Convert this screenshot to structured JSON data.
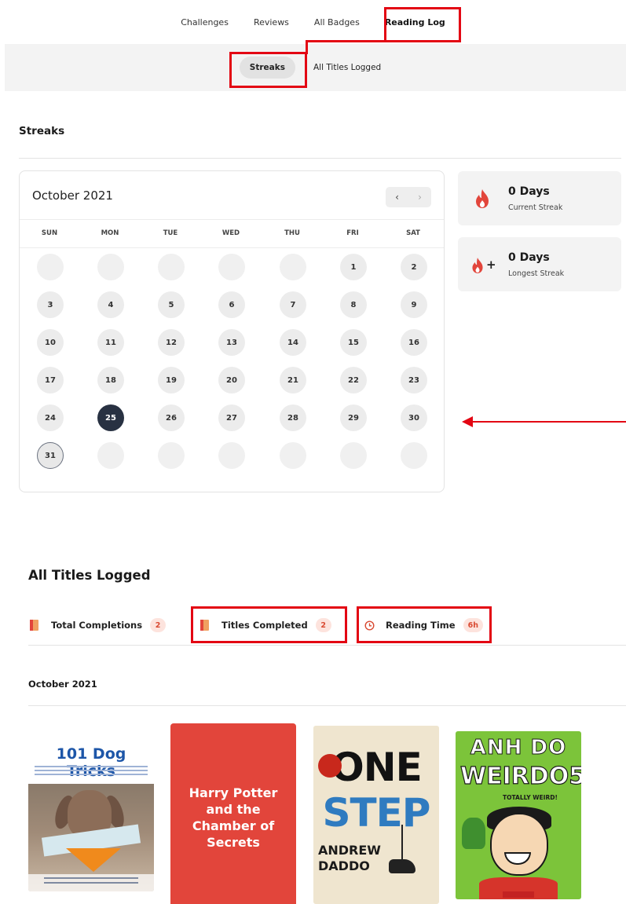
{
  "nav": {
    "tabs": [
      {
        "label": "Challenges"
      },
      {
        "label": "Reviews"
      },
      {
        "label": "All Badges"
      },
      {
        "label": "Reading Log"
      }
    ],
    "subtabs": [
      {
        "label": "Streaks"
      },
      {
        "label": "All Titles Logged"
      }
    ]
  },
  "streaks": {
    "heading": "Streaks",
    "calendar": {
      "month_label": "October 2021",
      "prev_icon": "‹",
      "next_icon": "›",
      "weekdays": [
        "SUN",
        "MON",
        "TUE",
        "WED",
        "THU",
        "FRI",
        "SAT"
      ],
      "days": [
        "1",
        "2",
        "3",
        "4",
        "5",
        "6",
        "7",
        "8",
        "9",
        "10",
        "11",
        "12",
        "13",
        "14",
        "15",
        "16",
        "17",
        "18",
        "19",
        "20",
        "21",
        "22",
        "23",
        "24",
        "25",
        "26",
        "27",
        "28",
        "29",
        "30",
        "31"
      ],
      "today": "25",
      "outlined": "31"
    },
    "current": {
      "value": "0 Days",
      "label": "Current Streak",
      "icon": "flame-icon"
    },
    "longest": {
      "value": "0 Days",
      "label": "Longest Streak",
      "icon": "flame-plus-icon",
      "plus": "+"
    }
  },
  "titles": {
    "heading": "All Titles Logged",
    "stats": [
      {
        "label": "Total Completions",
        "count": "2",
        "icon": "book-icon"
      },
      {
        "label": "Titles Completed",
        "count": "2",
        "icon": "book-icon"
      },
      {
        "label": "Reading Time",
        "count": "6h",
        "icon": "clock-icon"
      }
    ],
    "month_label": "October 2021",
    "books": [
      {
        "title": "101 Dog Tricks"
      },
      {
        "title": "Harry Potter and the Chamber of Secrets"
      },
      {
        "title_line1": "ONE",
        "title_line2": "STEP",
        "author_line1": "ANDREW",
        "author_line2": "DADDO"
      },
      {
        "author": "ANH DO",
        "title": "WEIRDO5",
        "subtitle": "TOTALLY WEIRD!"
      }
    ]
  },
  "colors": {
    "accent": "#e2453b",
    "highlight": "#e30613",
    "today": "#283142"
  }
}
